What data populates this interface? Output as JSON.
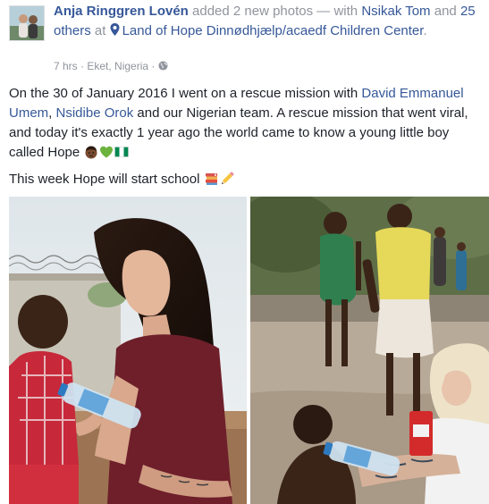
{
  "header": {
    "author": "Anja Ringgren Lovén",
    "action": " added 2 new photos — with ",
    "tagged_person": "Nsikak Tom",
    "and_text": " and ",
    "others": "25 others",
    "at_text": " at ",
    "place": "Land of Hope Dinnødhjælp/acaedf Children Center",
    "period": ".",
    "time": "7 hrs",
    "separator": " · ",
    "location": "Eket, Nigeria",
    "separator2": " ·"
  },
  "post": {
    "p1_before": "On the 30 of January 2016 I went on a rescue mission with ",
    "mention1": "David Emmanuel Umem",
    "comma": ", ",
    "mention2": "Nsidibe Orok",
    "p1_after": " and our Nigerian team. A rescue mission that went viral, and today it's exactly 1 year ago the world came to know a young little boy called Hope ",
    "p2": "This week Hope will start school "
  },
  "icons": {
    "avatar": "profile-photo",
    "location": "map-pin-icon",
    "audience": "globe-icon",
    "emoji_1": "boy-emoji",
    "emoji_2": "green-heart-emoji",
    "emoji_3": "nigeria-flag-emoji",
    "emoji_4": "books-emoji",
    "emoji_5": "pencil-emoji"
  },
  "colors": {
    "link": "#365899",
    "meta": "#90949c",
    "text": "#1d2129"
  }
}
